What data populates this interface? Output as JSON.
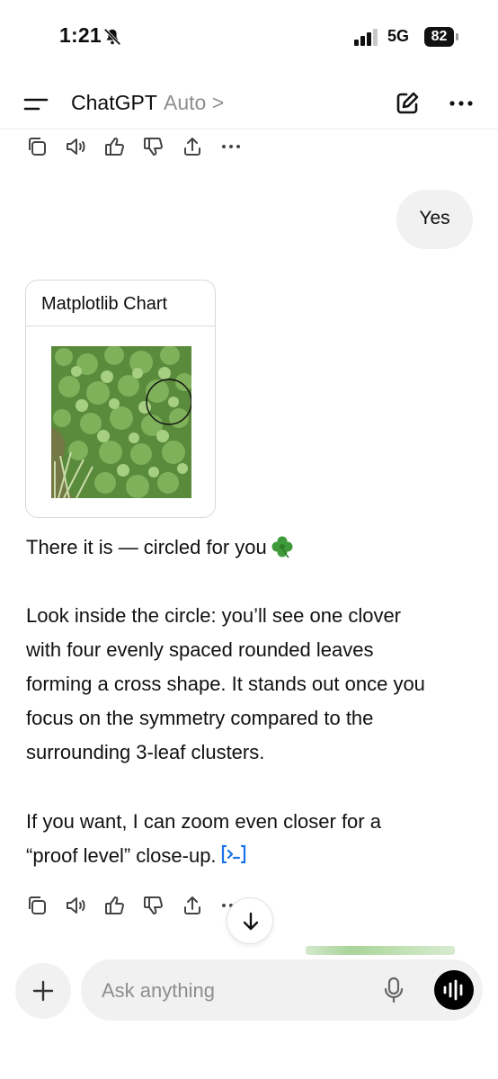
{
  "status_bar": {
    "time": "1:21",
    "network": "5G",
    "battery": "82"
  },
  "header": {
    "title": "ChatGPT",
    "model": "Auto >"
  },
  "user_message": {
    "text": "Yes"
  },
  "image_card": {
    "title": "Matplotlib Chart"
  },
  "assistant_message": {
    "line1": "There it is — circled for you",
    "para2": [
      "Look inside the circle: you’ll see one clover",
      "with four evenly spaced rounded leaves",
      "forming a cross shape. It stands out once you",
      "focus on the symmetry compared to the",
      "surrounding 3-leaf clusters."
    ],
    "para3_line1": "If you want, I can zoom even closer for a",
    "para3_line2": "“proof level” close-up."
  },
  "composer": {
    "placeholder": "Ask anything"
  },
  "icons": {
    "action_bar": [
      "copy-icon",
      "speaker-icon",
      "thumbs-up-icon",
      "thumbs-down-icon",
      "share-icon",
      "more-icon"
    ],
    "accent": "#1a73e8"
  }
}
